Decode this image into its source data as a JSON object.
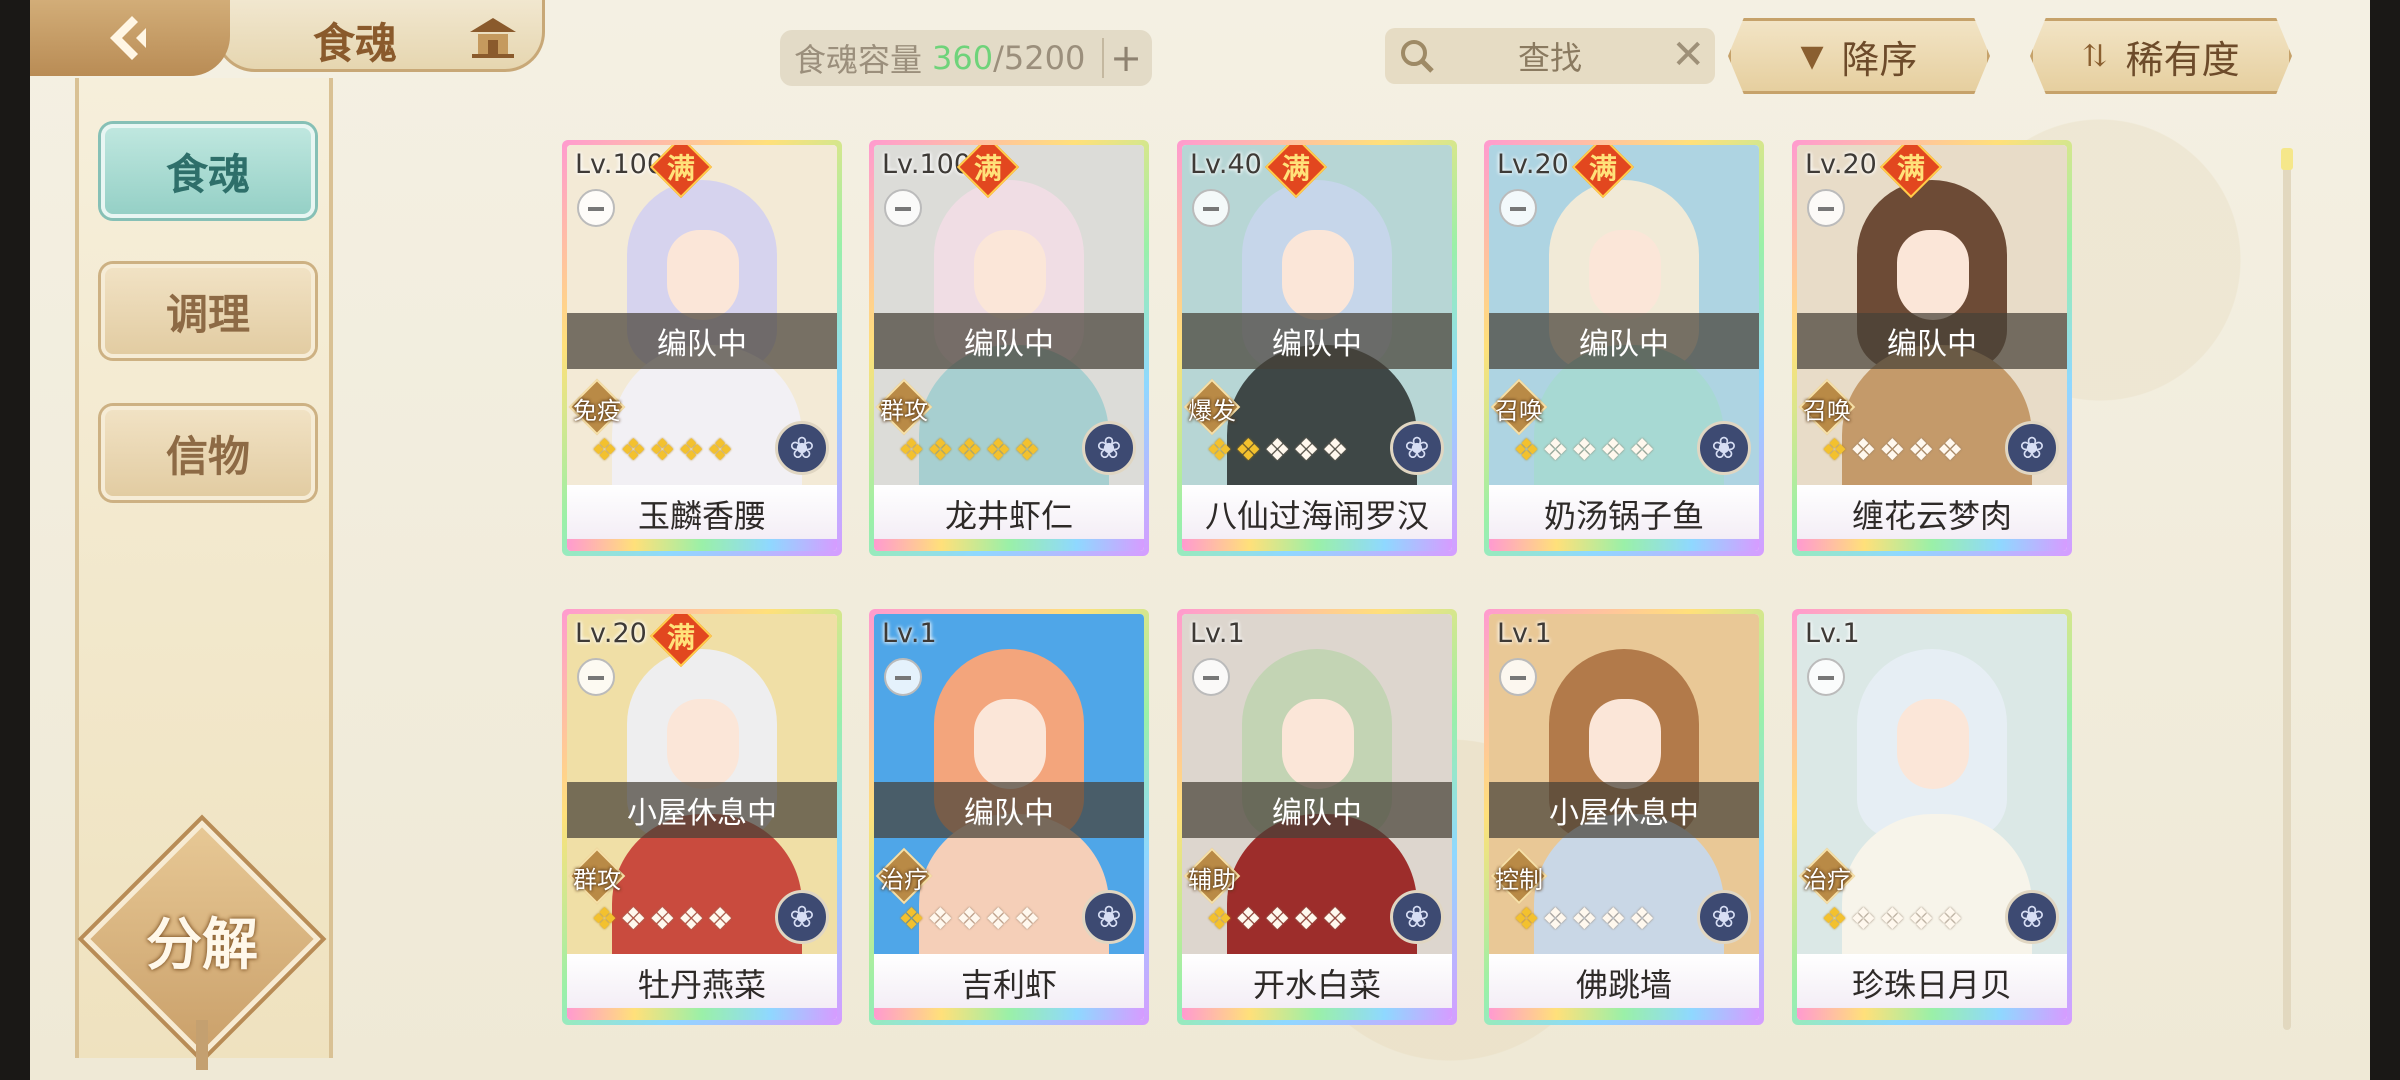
{
  "header": {
    "title": "食魂",
    "capacity_label": "食魂容量",
    "capacity_used": "360",
    "capacity_sep": "/",
    "capacity_max": "5200",
    "search_label": "查找",
    "sort_label": "降序",
    "rarity_label": "稀有度"
  },
  "sidebar": {
    "items": [
      {
        "label": "食魂",
        "active": true
      },
      {
        "label": "调理",
        "active": false
      },
      {
        "label": "信物",
        "active": false
      }
    ],
    "decompose_label": "分解"
  },
  "cards": [
    {
      "level": "Lv.100",
      "full": "满",
      "status": "编队中",
      "role": "免疫",
      "stars": 5,
      "name": "玉麟香腰",
      "hair": "#d6d3ee",
      "bg": "#f3ead6",
      "body": "#f2f0f4"
    },
    {
      "level": "Lv.100",
      "full": "满",
      "status": "编队中",
      "role": "群攻",
      "stars": 5,
      "name": "龙井虾仁",
      "hair": "#f0dde4",
      "bg": "#dcdcd8",
      "body": "#a7cfd0"
    },
    {
      "level": "Lv.40",
      "full": "满",
      "status": "编队中",
      "role": "爆发",
      "stars": 2,
      "name": "八仙过海闹罗汉",
      "hair": "#c6d6ea",
      "bg": "#b7d6d5",
      "body": "#3e4746"
    },
    {
      "level": "Lv.20",
      "full": "满",
      "status": "编队中",
      "role": "召唤",
      "stars": 1,
      "name": "奶汤锅子鱼",
      "hair": "#f1ead7",
      "bg": "#aed4e2",
      "body": "#a7d9d3"
    },
    {
      "level": "Lv.20",
      "full": "满",
      "status": "编队中",
      "role": "召唤",
      "stars": 1,
      "name": "缠花云梦肉",
      "hair": "#6d4b36",
      "bg": "#e8dcc8",
      "body": "#c49a6a"
    },
    {
      "level": "Lv.20",
      "full": "满",
      "status": "小屋休息中",
      "role": "群攻",
      "stars": 1,
      "name": "牡丹燕菜",
      "hair": "#eeeeef",
      "bg": "#f0dfa6",
      "body": "#c94b3e"
    },
    {
      "level": "Lv.1",
      "full": "",
      "status": "编队中",
      "role": "治疗",
      "stars": 1,
      "name": "吉利虾",
      "hair": "#f3a57c",
      "bg": "#4fa6e8",
      "body": "#f5cfb8"
    },
    {
      "level": "Lv.1",
      "full": "",
      "status": "编队中",
      "role": "辅助",
      "stars": 1,
      "name": "开水白菜",
      "hair": "#c3d4b4",
      "bg": "#ddd6ce",
      "body": "#9d2d2b"
    },
    {
      "level": "Lv.1",
      "full": "",
      "status": "小屋休息中",
      "role": "控制",
      "stars": 1,
      "name": "佛跳墙",
      "hair": "#b27a4a",
      "bg": "#e9c896",
      "body": "#c9d7e6"
    },
    {
      "level": "Lv.1",
      "full": "",
      "status": "",
      "role": "治疗",
      "stars": 1,
      "name": "珍珠日月贝",
      "hair": "#e6eef4",
      "bg": "#dbe8e6",
      "body": "#f7f4ea"
    }
  ]
}
